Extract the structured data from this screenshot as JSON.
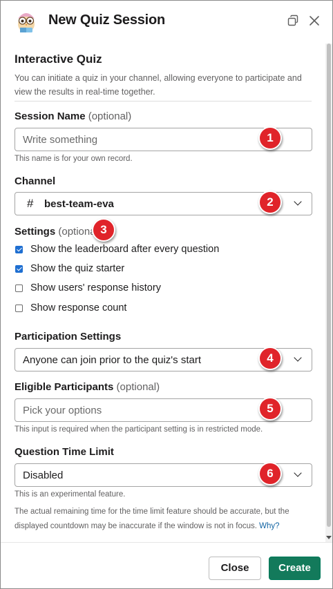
{
  "header": {
    "title": "New Quiz Session",
    "icons": [
      "owl-logo-icon",
      "copy-window-icon",
      "close-icon"
    ]
  },
  "intro": {
    "title": "Interactive Quiz",
    "description": "You can initiate a quiz in your channel, allowing everyone to participate and view the results in real-time together."
  },
  "session_name": {
    "label": "Session Name",
    "optional": "(optional)",
    "placeholder": "Write something",
    "help": "This name is for your own record."
  },
  "channel": {
    "label": "Channel",
    "hash": "#",
    "value": "best-team-eva"
  },
  "settings": {
    "label": "Settings",
    "optional": "(optional)",
    "options": [
      {
        "label": "Show the leaderboard after every question",
        "checked": true
      },
      {
        "label": "Show the quiz starter",
        "checked": true
      },
      {
        "label": "Show users' response history",
        "checked": false
      },
      {
        "label": "Show response count",
        "checked": false
      }
    ]
  },
  "participation": {
    "label": "Participation Settings",
    "value": "Anyone can join prior to the quiz's start"
  },
  "eligible": {
    "label": "Eligible Participants",
    "optional": "(optional)",
    "placeholder": "Pick your options",
    "help": "This input is required when the participant setting is in restricted mode."
  },
  "time_limit": {
    "label": "Question Time Limit",
    "value": "Disabled",
    "help": "This is an experimental feature.",
    "note": "The actual remaining time for the time limit feature should be accurate, but the displayed countdown may be inaccurate if the window is not in focus.",
    "link": "Why?"
  },
  "badges": [
    "1",
    "2",
    "3",
    "4",
    "5",
    "6"
  ],
  "footer": {
    "close_label": "Close",
    "create_label": "Create"
  },
  "colors": {
    "create_button": "#137a5b",
    "checkbox_checked": "#1f6fd1",
    "badge": "#e0242a",
    "link": "#1264a3"
  }
}
